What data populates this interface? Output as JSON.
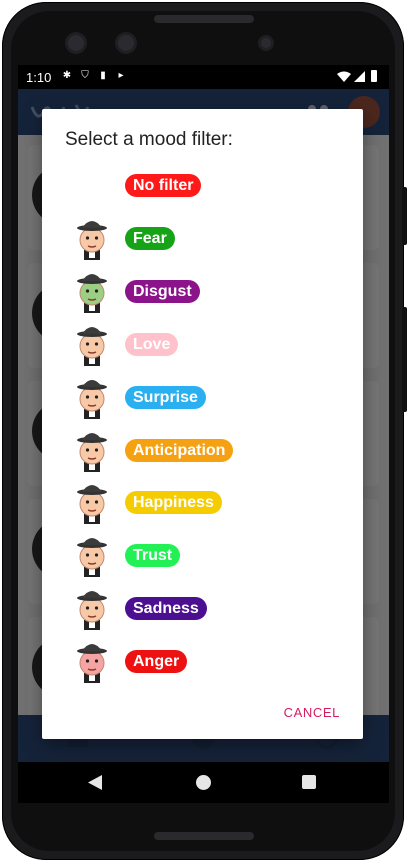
{
  "status_bar": {
    "time": "1:10"
  },
  "dialog": {
    "title": "Select a mood filter:",
    "cancel_label": "CANCEL",
    "moods": [
      {
        "label": "No filter",
        "color": "#ff1a1a",
        "has_icon": false,
        "face": ""
      },
      {
        "label": "Fear",
        "color": "#17a317",
        "has_icon": true,
        "face": "#f7c9a7"
      },
      {
        "label": "Disgust",
        "color": "#8b148b",
        "has_icon": true,
        "face": "#9ccf84"
      },
      {
        "label": "Love",
        "color": "#ffc1cc",
        "has_icon": true,
        "face": "#f7c9a7"
      },
      {
        "label": "Surprise",
        "color": "#2ab0f0",
        "has_icon": true,
        "face": "#f7c9a7"
      },
      {
        "label": "Anticipation",
        "color": "#f5a112",
        "has_icon": true,
        "face": "#f7c9a7"
      },
      {
        "label": "Happiness",
        "color": "#f5cc00",
        "has_icon": true,
        "face": "#f7c9a7"
      },
      {
        "label": "Trust",
        "color": "#22f055",
        "has_icon": true,
        "face": "#f7c9a7"
      },
      {
        "label": "Sadness",
        "color": "#4d0f91",
        "has_icon": true,
        "face": "#f7c9a7"
      },
      {
        "label": "Anger",
        "color": "#ee1111",
        "has_icon": true,
        "face": "#f6a3a3"
      }
    ]
  }
}
